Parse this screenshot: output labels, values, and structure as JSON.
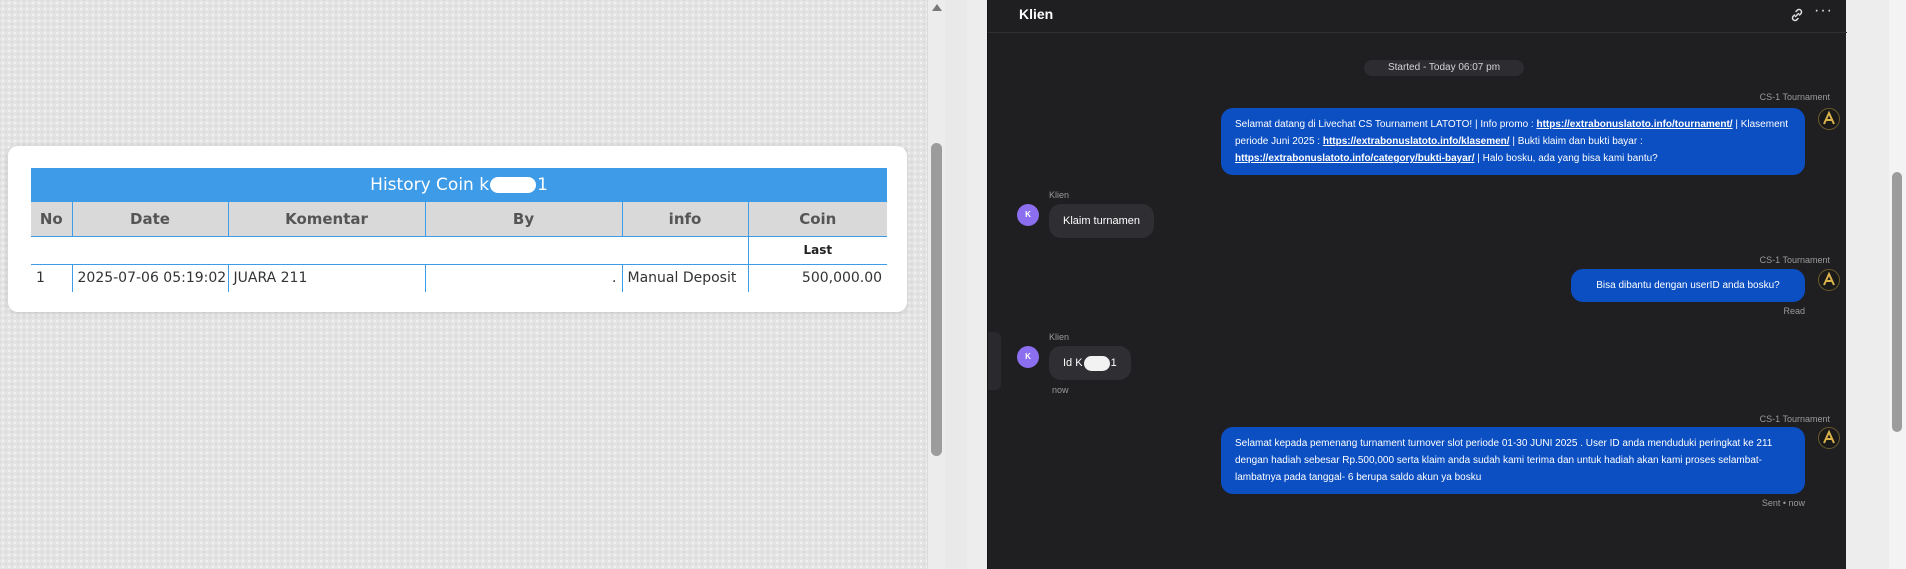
{
  "history": {
    "title_prefix": "History Coin k",
    "title_suffix": "1",
    "columns": [
      "No",
      "Date",
      "Komentar",
      "By",
      "info",
      "Coin"
    ],
    "sub_header": "Last",
    "rows": [
      {
        "no": "1",
        "date": "2025-07-06 05:19:02",
        "komentar": "JUARA 211",
        "by": ".",
        "info": "Manual Deposit",
        "coin": "500,000.00"
      }
    ]
  },
  "chat": {
    "title": "Klien",
    "icons": {
      "link": "link-icon",
      "more": "more-icon"
    },
    "more_label": "···",
    "started": "Started - Today 06:07 pm",
    "messages": [
      {
        "sender": "CS-1 Tournament",
        "segments": [
          "Selamat datang di Livechat CS Tournament LATOTO! | Info promo : ",
          "https://extrabonuslatoto.info/tournament/",
          " | Klasement periode Juni 2025 : ",
          "https://extrabonuslatoto.info/klasemen/",
          " | Bukti klaim dan bukti bayar : ",
          "https://extrabonuslatoto.info/category/bukti-bayar/",
          " | Halo bosku, ada yang bisa kami bantu?"
        ]
      },
      {
        "sender": "Klien",
        "avatar": "K",
        "text": "Klaim turnamen"
      },
      {
        "sender": "CS-1 Tournament",
        "text": "Bisa dibantu dengan userID anda bosku?",
        "status": "Read"
      },
      {
        "sender": "Klien",
        "avatar": "K",
        "text_prefix": "Id K",
        "text_suffix": "1",
        "time": "now"
      },
      {
        "sender": "CS-1 Tournament",
        "text": "Selamat kepada pemenang turnament turnover slot periode 01-30 JUNI 2025 . User ID anda menduduki peringkat ke 211 dengan hadiah sebesar Rp.500,000 serta klaim anda sudah kami terima dan untuk hadiah akan kami proses selambat-lambatnya pada tanggal- 6 berupa saldo akun ya bosku",
        "status": "Sent • now"
      }
    ]
  }
}
